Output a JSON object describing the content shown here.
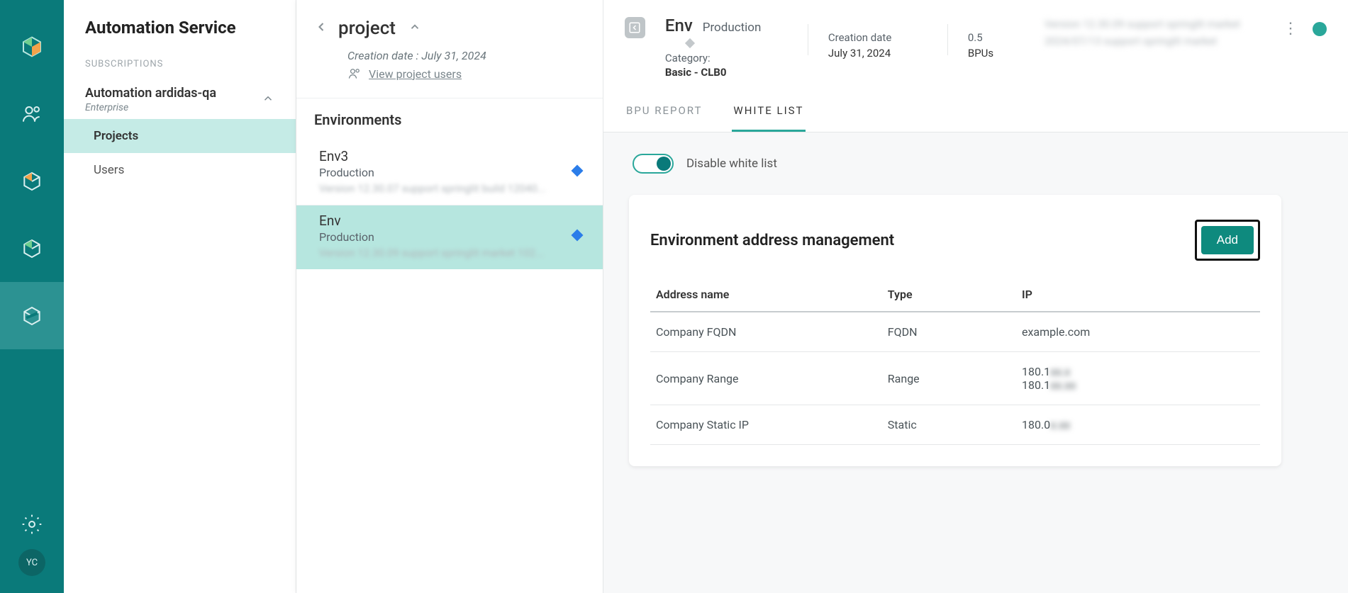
{
  "rail": {
    "avatar_initials": "YC"
  },
  "sidebar": {
    "title": "Automation Service",
    "section_label": "SUBSCRIPTIONS",
    "subscription": {
      "name": "Automation ardidas-qa",
      "tier": "Enterprise"
    },
    "nav": {
      "projects": "Projects",
      "users": "Users"
    }
  },
  "project_panel": {
    "title": "project",
    "creation_label": "Creation date :",
    "creation_date": "July 31, 2024",
    "view_users": "View project users",
    "environments_label": "Environments",
    "envs": [
      {
        "name": "Env3",
        "type": "Production",
        "version_blur": "Version 12.30.07 support springlit build 12040..."
      },
      {
        "name": "Env",
        "type": "Production",
        "version_blur": "Version 12.30.09 support springlit market 102..."
      }
    ]
  },
  "env_header": {
    "name": "Env",
    "type": "Production",
    "category_label": "Category:",
    "category_value": "Basic - CLB0",
    "creation_label": "Creation date",
    "creation_date": "July 31, 2024",
    "bpu_value": "0.5",
    "bpu_label": "BPUs",
    "blur_text": "Version 12.30.09 support springlit market 2024/07/13 support springlit market"
  },
  "tabs": {
    "bpu": "BPU REPORT",
    "whitelist": "WHITE LIST"
  },
  "whitelist": {
    "toggle_label": "Disable white list",
    "card_title": "Environment address management",
    "add_label": "Add",
    "cols": {
      "name": "Address name",
      "type": "Type",
      "ip": "IP"
    },
    "rows": [
      {
        "name": "Company FQDN",
        "type": "FQDN",
        "ip": "example.com"
      },
      {
        "name": "Company Range",
        "type": "Range",
        "ip": "180.1",
        "ip2": "180.1",
        "blur1": "xx.x",
        "blur2": "xx.xx"
      },
      {
        "name": "Company Static IP",
        "type": "Static",
        "ip": "180.0",
        "blur1": "x.xx"
      }
    ]
  }
}
